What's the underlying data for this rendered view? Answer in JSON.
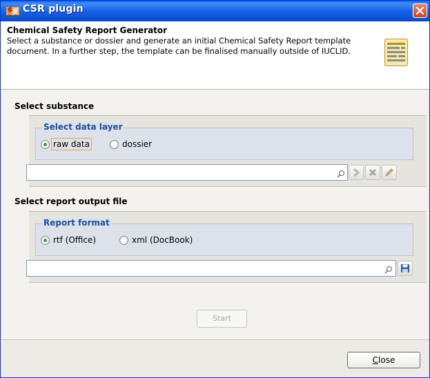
{
  "window": {
    "title": "CSR plugin",
    "accent": "#0a5fe0"
  },
  "header": {
    "title": "Chemical Safety Report Generator",
    "description": "Select a substance or dossier and generate an initial Chemical Safety Report template document. In a further step, the template can be finalised manually outside of IUCLID.",
    "icon": "document-icon"
  },
  "select_substance": {
    "title": "Select substance",
    "data_layer": {
      "legend": "Select data layer",
      "options": [
        {
          "label": "raw data",
          "selected": true
        },
        {
          "label": "dossier",
          "selected": false
        }
      ]
    },
    "field_value": "",
    "buttons": [
      "search-icon",
      "go-icon",
      "clear-icon",
      "edit-icon"
    ]
  },
  "report_output": {
    "title": "Select report output file",
    "format": {
      "legend": "Report format",
      "options": [
        {
          "label": "rtf (Office)",
          "selected": true
        },
        {
          "label": "xml (DocBook)",
          "selected": false
        }
      ]
    },
    "field_value": "",
    "buttons": [
      "search-icon",
      "save-icon"
    ]
  },
  "actions": {
    "start": "Start",
    "close_mnemonic": "C",
    "close_rest": "lose"
  }
}
